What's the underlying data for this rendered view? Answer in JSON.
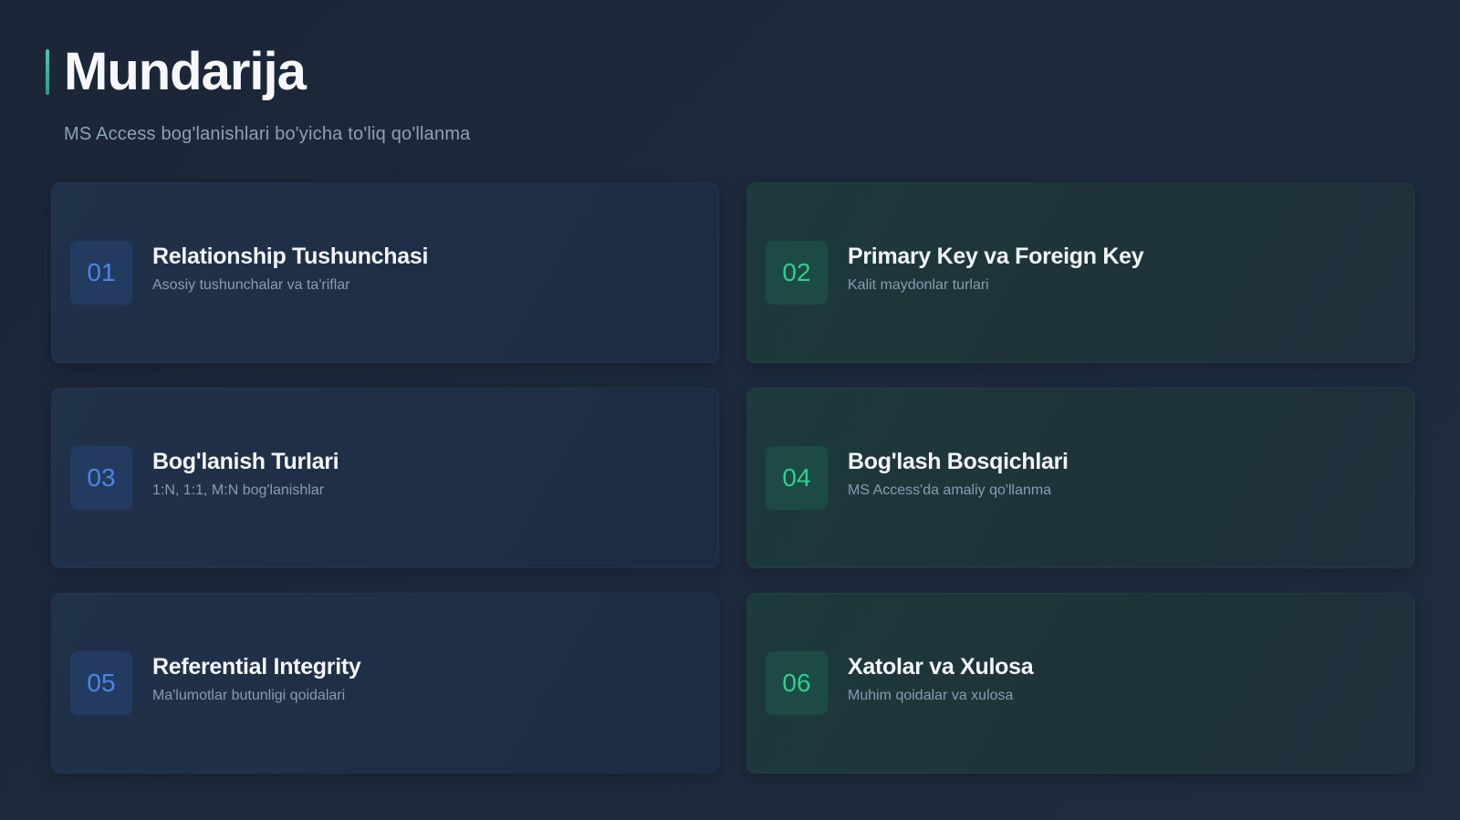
{
  "header": {
    "title": "Mundarija",
    "subtitle": "MS Access bog'lanishlari bo'yicha to'liq qo'llanma"
  },
  "colors": {
    "accent": "#3fd0a8",
    "blue_number": "#4d84e6",
    "green_number": "#2fcf91"
  },
  "items": [
    {
      "number": "01",
      "title": "Relationship Tushunchasi",
      "description": "Asosiy tushunchalar va ta'riflar"
    },
    {
      "number": "02",
      "title": "Primary Key va Foreign Key",
      "description": "Kalit maydonlar turlari"
    },
    {
      "number": "03",
      "title": "Bog'lanish Turlari",
      "description": "1:N, 1:1, M:N bog'lanishlar"
    },
    {
      "number": "04",
      "title": "Bog'lash Bosqichlari",
      "description": "MS Access'da amaliy qo'llanma"
    },
    {
      "number": "05",
      "title": "Referential Integrity",
      "description": "Ma'lumotlar butunligi qoidalari"
    },
    {
      "number": "06",
      "title": "Xatolar va Xulosa",
      "description": "Muhim qoidalar va xulosa"
    }
  ]
}
